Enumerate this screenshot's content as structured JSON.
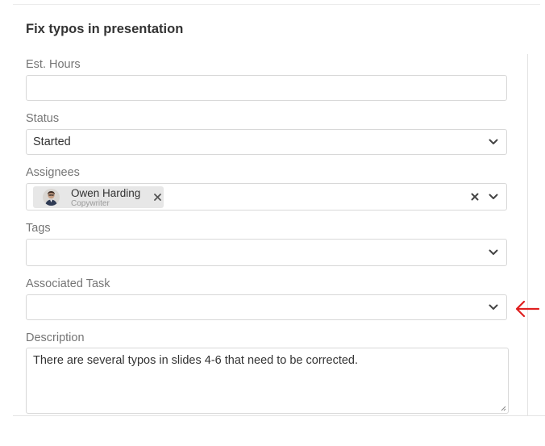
{
  "task": {
    "title": "Fix typos in presentation"
  },
  "fields": {
    "est_hours": {
      "label": "Est. Hours",
      "value": ""
    },
    "status": {
      "label": "Status",
      "value": "Started"
    },
    "assignees": {
      "label": "Assignees",
      "chips": [
        {
          "name": "Owen Harding",
          "role": "Copywriter"
        }
      ]
    },
    "tags": {
      "label": "Tags",
      "value": ""
    },
    "associated_task": {
      "label": "Associated Task",
      "value": ""
    },
    "description": {
      "label": "Description",
      "value": "There are several typos in slides 4-6 that need to be corrected."
    }
  },
  "annotation": {
    "arrow_color": "#e02020",
    "icon": "arrow-left-icon"
  },
  "colors": {
    "border": "#d8d8d8",
    "chip_bg": "#e7e7e7",
    "label": "#757575"
  }
}
